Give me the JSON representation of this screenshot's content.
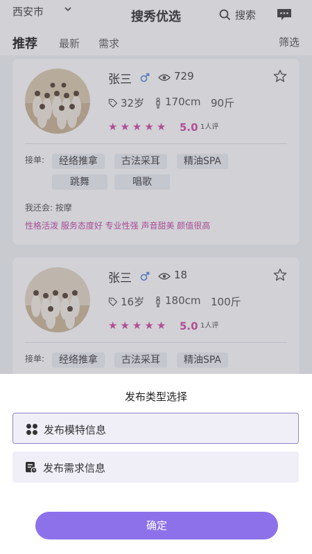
{
  "header": {
    "city": "西安市",
    "title": "搜秀优选",
    "search_label": "搜索"
  },
  "tabs": [
    {
      "label": "推荐",
      "active": true
    },
    {
      "label": "最新",
      "active": false
    },
    {
      "label": "需求",
      "active": false
    }
  ],
  "filter_label": "筛选",
  "cards": [
    {
      "name": "张三",
      "views": "729",
      "age": "32岁",
      "height": "170cm",
      "weight": "90斤",
      "stars": 5,
      "rating": "5.0",
      "rating_count": "1人评",
      "orders_label": "接单:",
      "services": [
        "经络推拿",
        "古法采耳",
        "精油SPA",
        "跳舞",
        "唱歌"
      ],
      "also_label": "我还会: 按摩",
      "traits": "性格活泼 服务态度好 专业性强 声音甜美 颜值很高"
    },
    {
      "name": "张三",
      "views": "18",
      "age": "16岁",
      "height": "180cm",
      "weight": "100斤",
      "stars": 5,
      "rating": "5.0",
      "rating_count": "1人评",
      "orders_label": "接单:",
      "services": [
        "经络推拿",
        "古法采耳",
        "精油SPA"
      ]
    }
  ],
  "sheet": {
    "title": "发布类型选择",
    "options": [
      {
        "label": "发布模特信息",
        "icon": "grid-icon",
        "selected": true
      },
      {
        "label": "发布需求信息",
        "icon": "document-icon",
        "selected": false
      }
    ],
    "confirm_label": "确定"
  },
  "colors": {
    "accent": "#8d71ea",
    "rating": "#d03f9e",
    "male": "#4a7fd6"
  }
}
